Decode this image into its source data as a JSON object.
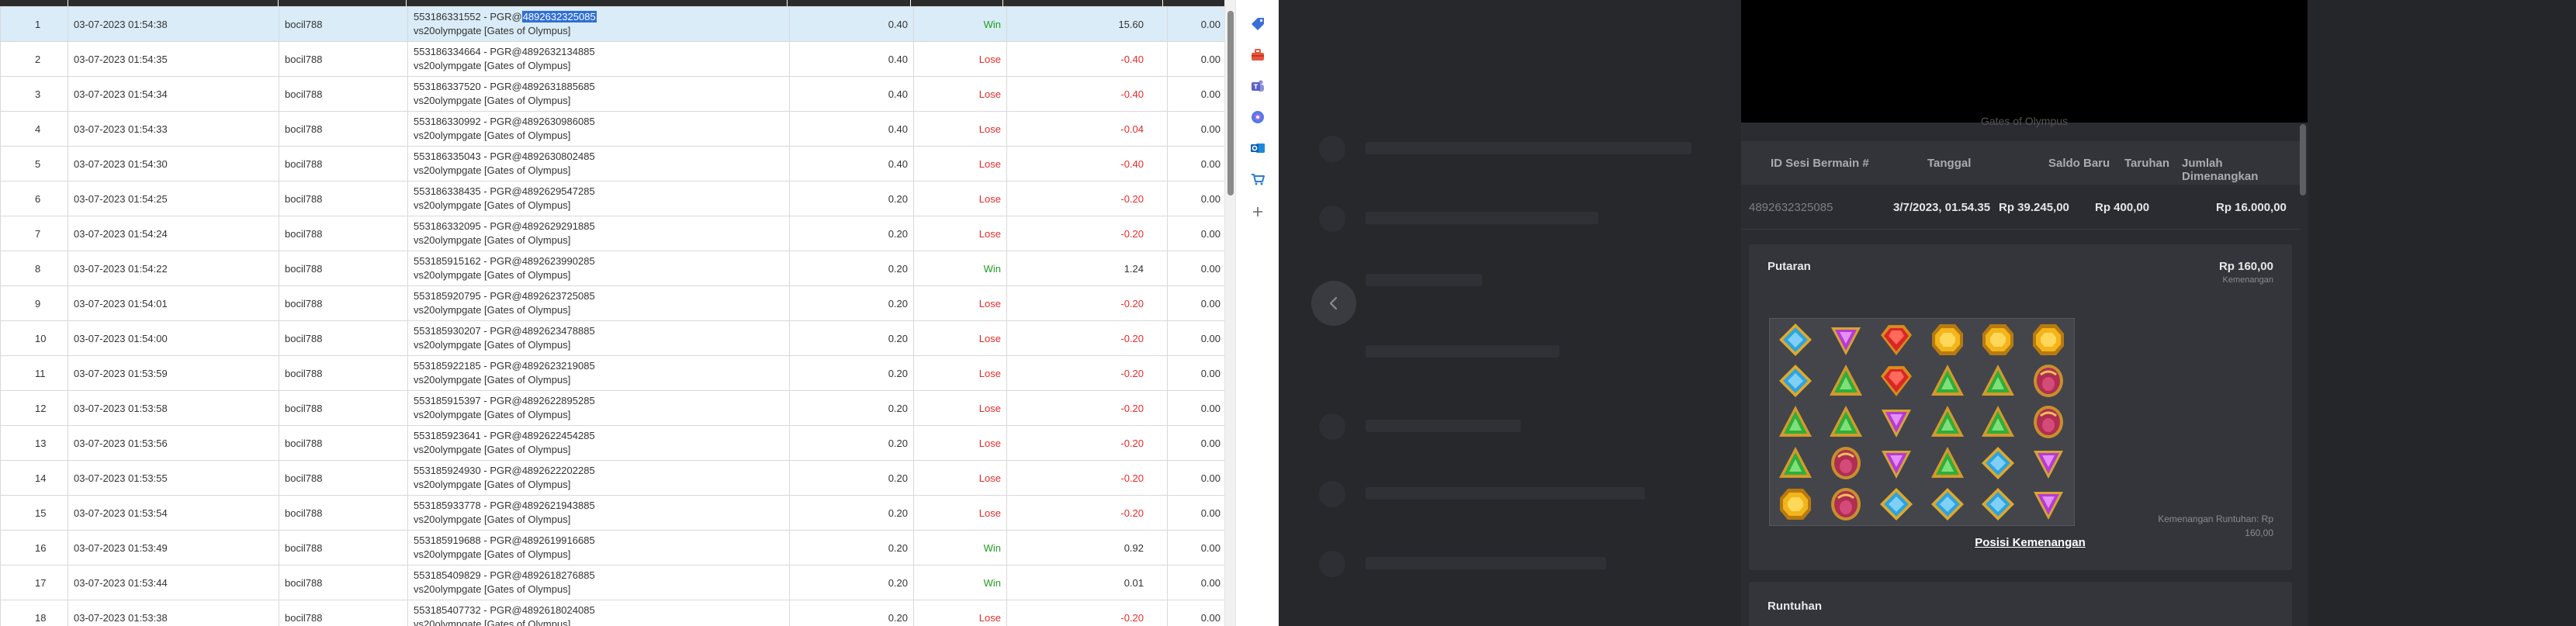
{
  "table": {
    "rows": [
      {
        "no": "1",
        "date": "03-07-2023 01:54:38",
        "user": "bocil788",
        "desc_prefix": "553186331552 - PGR@",
        "desc_id": "4892632325085",
        "desc_game": "vs20olympgate [Gates of Olympus]",
        "bet": "0.40",
        "result": "Win",
        "winloss": "15.60",
        "jackpot": "0.00"
      },
      {
        "no": "2",
        "date": "03-07-2023 01:54:35",
        "user": "bocil788",
        "desc_prefix": "553186334664 - PGR@",
        "desc_id": "4892632134885",
        "desc_game": "vs20olympgate [Gates of Olympus]",
        "bet": "0.40",
        "result": "Lose",
        "winloss": "-0.40",
        "jackpot": "0.00"
      },
      {
        "no": "3",
        "date": "03-07-2023 01:54:34",
        "user": "bocil788",
        "desc_prefix": "553186337520 - PGR@",
        "desc_id": "4892631885685",
        "desc_game": "vs20olympgate [Gates of Olympus]",
        "bet": "0.40",
        "result": "Lose",
        "winloss": "-0.40",
        "jackpot": "0.00"
      },
      {
        "no": "4",
        "date": "03-07-2023 01:54:33",
        "user": "bocil788",
        "desc_prefix": "553186330992 - PGR@",
        "desc_id": "4892630986085",
        "desc_game": "vs20olympgate [Gates of Olympus]",
        "bet": "0.40",
        "result": "Lose",
        "winloss": "-0.04",
        "jackpot": "0.00"
      },
      {
        "no": "5",
        "date": "03-07-2023 01:54:30",
        "user": "bocil788",
        "desc_prefix": "553186335043 - PGR@",
        "desc_id": "4892630802485",
        "desc_game": "vs20olympgate [Gates of Olympus]",
        "bet": "0.40",
        "result": "Lose",
        "winloss": "-0.40",
        "jackpot": "0.00"
      },
      {
        "no": "6",
        "date": "03-07-2023 01:54:25",
        "user": "bocil788",
        "desc_prefix": "553186338435 - PGR@",
        "desc_id": "4892629547285",
        "desc_game": "vs20olympgate [Gates of Olympus]",
        "bet": "0.20",
        "result": "Lose",
        "winloss": "-0.20",
        "jackpot": "0.00"
      },
      {
        "no": "7",
        "date": "03-07-2023 01:54:24",
        "user": "bocil788",
        "desc_prefix": "553186332095 - PGR@",
        "desc_id": "4892629291885",
        "desc_game": "vs20olympgate [Gates of Olympus]",
        "bet": "0.20",
        "result": "Lose",
        "winloss": "-0.20",
        "jackpot": "0.00"
      },
      {
        "no": "8",
        "date": "03-07-2023 01:54:22",
        "user": "bocil788",
        "desc_prefix": "553185915162 - PGR@",
        "desc_id": "4892623990285",
        "desc_game": "vs20olympgate [Gates of Olympus]",
        "bet": "0.20",
        "result": "Win",
        "winloss": "1.24",
        "jackpot": "0.00"
      },
      {
        "no": "9",
        "date": "03-07-2023 01:54:01",
        "user": "bocil788",
        "desc_prefix": "553185920795 - PGR@",
        "desc_id": "4892623725085",
        "desc_game": "vs20olympgate [Gates of Olympus]",
        "bet": "0.20",
        "result": "Lose",
        "winloss": "-0.20",
        "jackpot": "0.00"
      },
      {
        "no": "10",
        "date": "03-07-2023 01:54:00",
        "user": "bocil788",
        "desc_prefix": "553185930207 - PGR@",
        "desc_id": "4892623478885",
        "desc_game": "vs20olympgate [Gates of Olympus]",
        "bet": "0.20",
        "result": "Lose",
        "winloss": "-0.20",
        "jackpot": "0.00"
      },
      {
        "no": "11",
        "date": "03-07-2023 01:53:59",
        "user": "bocil788",
        "desc_prefix": "553185922185 - PGR@",
        "desc_id": "4892623219085",
        "desc_game": "vs20olympgate [Gates of Olympus]",
        "bet": "0.20",
        "result": "Lose",
        "winloss": "-0.20",
        "jackpot": "0.00"
      },
      {
        "no": "12",
        "date": "03-07-2023 01:53:58",
        "user": "bocil788",
        "desc_prefix": "553185915397 - PGR@",
        "desc_id": "4892622895285",
        "desc_game": "vs20olympgate [Gates of Olympus]",
        "bet": "0.20",
        "result": "Lose",
        "winloss": "-0.20",
        "jackpot": "0.00"
      },
      {
        "no": "13",
        "date": "03-07-2023 01:53:56",
        "user": "bocil788",
        "desc_prefix": "553185923641 - PGR@",
        "desc_id": "4892622454285",
        "desc_game": "vs20olympgate [Gates of Olympus]",
        "bet": "0.20",
        "result": "Lose",
        "winloss": "-0.20",
        "jackpot": "0.00"
      },
      {
        "no": "14",
        "date": "03-07-2023 01:53:55",
        "user": "bocil788",
        "desc_prefix": "553185924930 - PGR@",
        "desc_id": "4892622202285",
        "desc_game": "vs20olympgate [Gates of Olympus]",
        "bet": "0.20",
        "result": "Lose",
        "winloss": "-0.20",
        "jackpot": "0.00"
      },
      {
        "no": "15",
        "date": "03-07-2023 01:53:54",
        "user": "bocil788",
        "desc_prefix": "553185933778 - PGR@",
        "desc_id": "4892621943885",
        "desc_game": "vs20olympgate [Gates of Olympus]",
        "bet": "0.20",
        "result": "Lose",
        "winloss": "-0.20",
        "jackpot": "0.00"
      },
      {
        "no": "16",
        "date": "03-07-2023 01:53:49",
        "user": "bocil788",
        "desc_prefix": "553185919688 - PGR@",
        "desc_id": "4892619916685",
        "desc_game": "vs20olympgate [Gates of Olympus]",
        "bet": "0.20",
        "result": "Win",
        "winloss": "0.92",
        "jackpot": "0.00"
      },
      {
        "no": "17",
        "date": "03-07-2023 01:53:44",
        "user": "bocil788",
        "desc_prefix": "553185409829 - PGR@",
        "desc_id": "4892618276885",
        "desc_game": "vs20olympgate [Gates of Olympus]",
        "bet": "0.20",
        "result": "Win",
        "winloss": "0.01",
        "jackpot": "0.00"
      },
      {
        "no": "18",
        "date": "03-07-2023 01:53:38",
        "user": "bocil788",
        "desc_prefix": "553185407732 - PGR@",
        "desc_id": "4892618024085",
        "desc_game": "vs20olympgate [Gates of Olympus]",
        "bet": "0.20",
        "result": "Lose",
        "winloss": "-0.20",
        "jackpot": "0.00"
      }
    ],
    "selected_row": 0,
    "colors": {
      "win": "#1f9d1f",
      "lose": "#e52a2a",
      "selected_bg": "#d9ecf7",
      "highlight": "#2f6fd6"
    }
  },
  "icon_strip": {
    "icons": [
      "tag-icon",
      "toolbox-icon",
      "teams-icon",
      "copilot-icon",
      "outlook-icon",
      "cart-icon",
      "plus-icon"
    ]
  },
  "history": {
    "game_caption": "Gates of Olympus",
    "columns": [
      "ID Sesi Bermain #",
      "Tanggal",
      "Saldo Baru",
      "Taruhan",
      "Jumlah Dimenangkan"
    ],
    "session": {
      "id": "4892632325085",
      "date": "3/7/2023, 01.54.35",
      "balance": "Rp 39.245,00",
      "bet": "Rp 400,00",
      "won": "Rp 16.000,00"
    },
    "spin": {
      "title": "Putaran",
      "amount": "Rp 160,00",
      "amount_label": "Kemenangan",
      "tumble_win_label": "Kemenangan Runtuhan: Rp",
      "tumble_win_value": "160,00",
      "win_positions_link": "Posisi Kemenangan",
      "grid": [
        [
          "blue-gem",
          "purple-gem",
          "red-gem",
          "gold-gem",
          "gold-gem",
          "gold-gem"
        ],
        [
          "blue-gem",
          "green-gem",
          "red-gem",
          "green-gem",
          "green-gem",
          "chalice"
        ],
        [
          "green-gem",
          "green-gem",
          "purple-gem",
          "green-gem",
          "green-gem",
          "chalice"
        ],
        [
          "green-gem",
          "chalice",
          "purple-gem",
          "green-gem",
          "blue-gem",
          "purple-gem"
        ],
        [
          "gold-gem",
          "chalice",
          "blue-gem",
          "blue-gem",
          "blue-gem",
          "purple-gem"
        ]
      ]
    },
    "tumble_title": "Runtuhan"
  }
}
